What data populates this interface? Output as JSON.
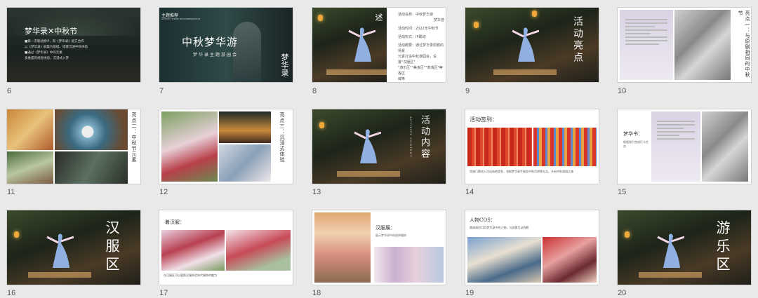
{
  "slides": [
    {
      "num": "6",
      "title": "梦华录✕中秋节",
      "lines": [
        "■第一次联动原IP，和《梦华录》剧方合作",
        "以《梦华录》剧集为基础，搭建沉浸中秋体验",
        "■通过《梦华录》中的元素",
        "多维度的视觉体验，沉浸式入梦"
      ]
    },
    {
      "num": "7",
      "tag": "主题推荐",
      "tag_sub": "ACTIVITY THEME RECOMMENDATION",
      "title": "中秋梦华游",
      "subtitle": "梦华录主题游园会",
      "logo": "梦华录"
    },
    {
      "num": "8",
      "title": "活动概述",
      "lines": [
        "活动名称：中秋梦华游",
        "梦华游",
        "活动时间：2022年中秋节",
        "活动形式：IP联动",
        "活动概要：通过梦华录原剧的场景",
        "元素打造中秋游园会，设置\"汉服区\"",
        "\"游乐区\"\"美食区\"\"表演区\"等各区",
        "域等"
      ]
    },
    {
      "num": "9",
      "title": "活动亮点"
    },
    {
      "num": "10",
      "title": "亮点一：与原剧相同的中秋节"
    },
    {
      "num": "11",
      "title": "亮点二：中秋节元素"
    },
    {
      "num": "12",
      "title": "亮点三：沉浸式体验"
    },
    {
      "num": "13",
      "title": "活动内容",
      "subtitle": "ACTIVITY CONTENT"
    },
    {
      "num": "14",
      "title": "活动签到：",
      "caption": "凭借门票进入活动场地签到，领取梦华录手册及中秋月饼等礼品，开启中秋游园之旅"
    },
    {
      "num": "15",
      "title": "梦华书：",
      "caption": "根据指引完成打卡任务"
    },
    {
      "num": "16",
      "title": "汉服区"
    },
    {
      "num": "17",
      "title": "着汉服：",
      "caption": "在汉服区可以更换汉服体验宋代服饰的魅力"
    },
    {
      "num": "18",
      "title": "汉服展：",
      "caption": "展示梦华录中的经典服饰"
    },
    {
      "num": "19",
      "title": "人物COS：",
      "caption": "邀请演员COS梦华录中的人物，与游客互动合影"
    },
    {
      "num": "20",
      "title": "游乐区"
    }
  ],
  "colors": {
    "accent": "#c4483c",
    "bg": "#e9e9e9"
  }
}
